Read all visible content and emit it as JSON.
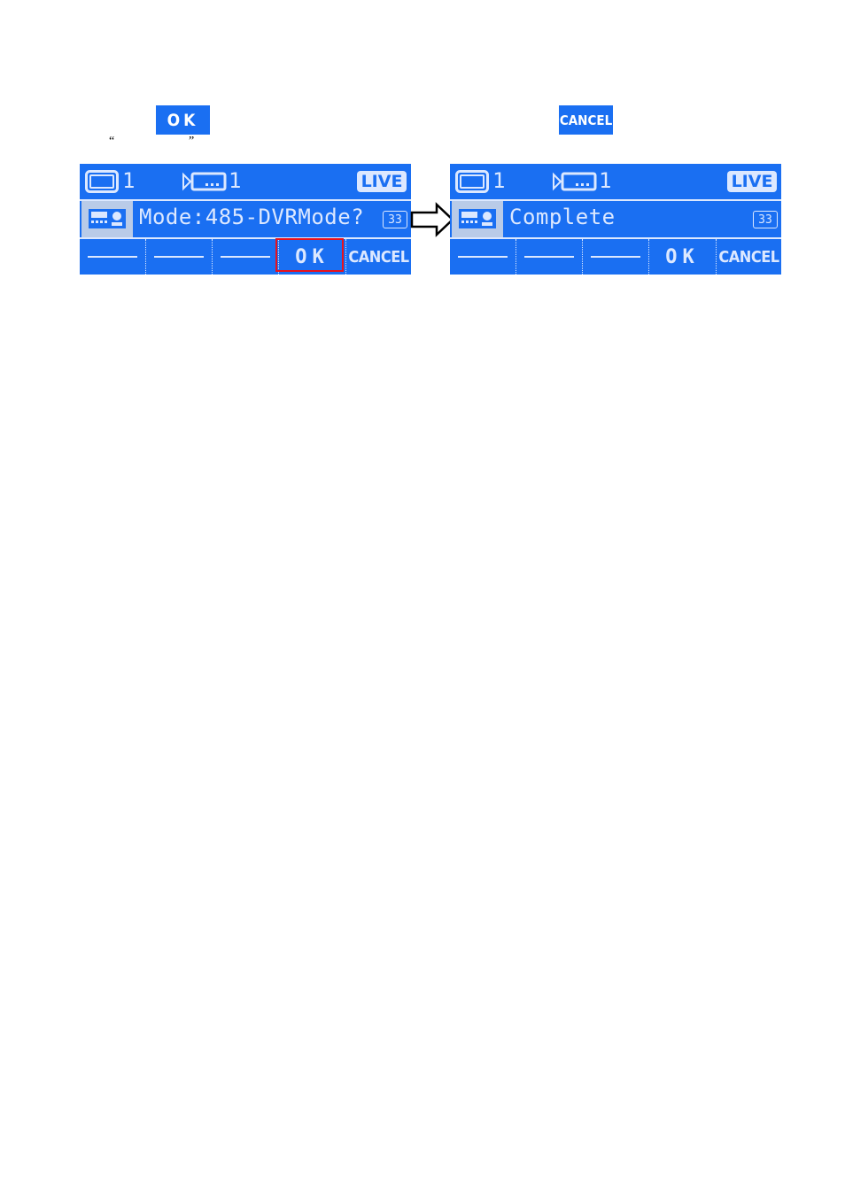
{
  "instructions": {
    "ok_chip_label": "OK",
    "cancel_chip_label": "CANCEL",
    "quote_open": "“",
    "quote_close": "”"
  },
  "colors": {
    "screen_blue": "#1a6ff2",
    "screen_text": "#dce8ff",
    "highlight_red": "#e8121c"
  },
  "panels": [
    {
      "id": "before",
      "monitor_count": "1",
      "camera_count": "1",
      "live_label": "LIVE",
      "message": "Mode:485-DVRMode?",
      "badge": "33",
      "softkeys": [
        "",
        "",
        "",
        "OK",
        "CANCEL"
      ],
      "highlighted_softkey": "OK"
    },
    {
      "id": "after",
      "monitor_count": "1",
      "camera_count": "1",
      "live_label": "LIVE",
      "message": "Complete",
      "badge": "33",
      "softkeys": [
        "",
        "",
        "",
        "OK",
        "CANCEL"
      ]
    }
  ],
  "transition_icon": "right-arrow-icon"
}
